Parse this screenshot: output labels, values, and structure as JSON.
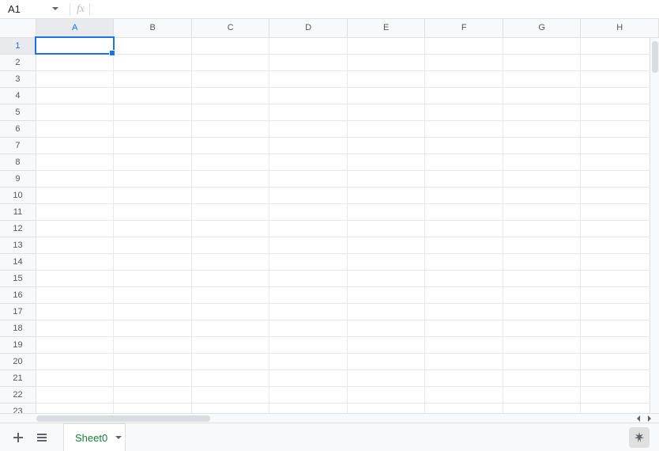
{
  "formula_bar": {
    "cell_reference": "A1",
    "fx_label": "fx",
    "formula_value": ""
  },
  "grid": {
    "columns": [
      "A",
      "B",
      "C",
      "D",
      "E",
      "F",
      "G",
      "H"
    ],
    "rows": [
      "1",
      "2",
      "3",
      "4",
      "5",
      "6",
      "7",
      "8",
      "9",
      "10",
      "11",
      "12",
      "13",
      "14",
      "15",
      "16",
      "17",
      "18",
      "19",
      "20",
      "21",
      "22",
      "23"
    ],
    "active_cell": {
      "col": "A",
      "row": "1"
    },
    "cells": {}
  },
  "sheet_bar": {
    "add_icon": "plus-icon",
    "all_sheets_icon": "menu-icon",
    "active_tab": "Sheet0",
    "explore_icon": "explore-icon"
  }
}
